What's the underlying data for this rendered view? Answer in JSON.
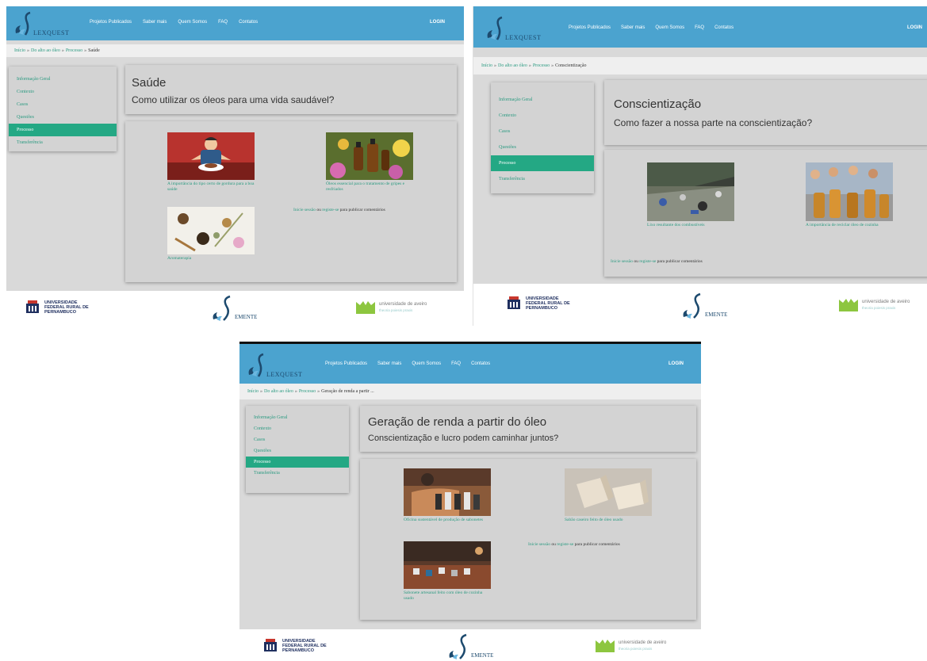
{
  "colors": {
    "topbar": "#4ba3cf",
    "accent": "#24a884",
    "link": "#2a9a80",
    "panel": "#d3d3d3"
  },
  "brand": {
    "logo_text": "LEXQUEST",
    "semente_text": "EMENTE"
  },
  "nav": [
    "Projetos Publicados",
    "Saber mais",
    "Quem Somos",
    "FAQ",
    "Contatos"
  ],
  "login": "LOGIN",
  "sidebar": [
    "Informação Geral",
    "Contexto",
    "Casos",
    "Questões",
    "Processo",
    "Transferência"
  ],
  "comment": {
    "login": "Inicie sessão",
    "or": " ou ",
    "register": "registe-se",
    "rest": " para publicar comentários"
  },
  "footer": {
    "ufrpe": "UNIVERSIDADE FEDERAL RURAL DE PERNAMBUCO",
    "aveiro": "universidade de aveiro",
    "aveiro_sub": "theoria poiesis praxis"
  },
  "screens": [
    {
      "breadcrumb": [
        "Início",
        "Do alto ao óleo",
        "Processo",
        "Saúde"
      ],
      "title": "Saúde",
      "subtitle": "Como utilizar os óleos para uma vida saudável?",
      "cards": [
        "A importância do tipo certo de gordura para a boa saúde",
        "Óleos essencial para o tratamento de gripes e resfriados",
        "Aromaterapia"
      ]
    },
    {
      "breadcrumb": [
        "Início",
        "Do alto ao óleo",
        "Processo",
        "Conscientização"
      ],
      "title": "Conscientização",
      "subtitle": "Como fazer a nossa parte na conscientização?",
      "cards": [
        "Lixo resultante dos combustíveis",
        "A importância de reciclar óleo de cozinha"
      ]
    },
    {
      "breadcrumb": [
        "Início",
        "Do alto ao óleo",
        "Processo",
        "Geração de renda a partir ..."
      ],
      "title": "Geração de renda a partir do óleo",
      "subtitle": "Conscientização e lucro podem caminhar juntos?",
      "cards": [
        "Oficina sustentável de produção de sabonetes",
        "Sabão caseiro feito de óleo usado",
        "Sabonete artesanal feito com óleo de cozinha usado"
      ]
    }
  ]
}
